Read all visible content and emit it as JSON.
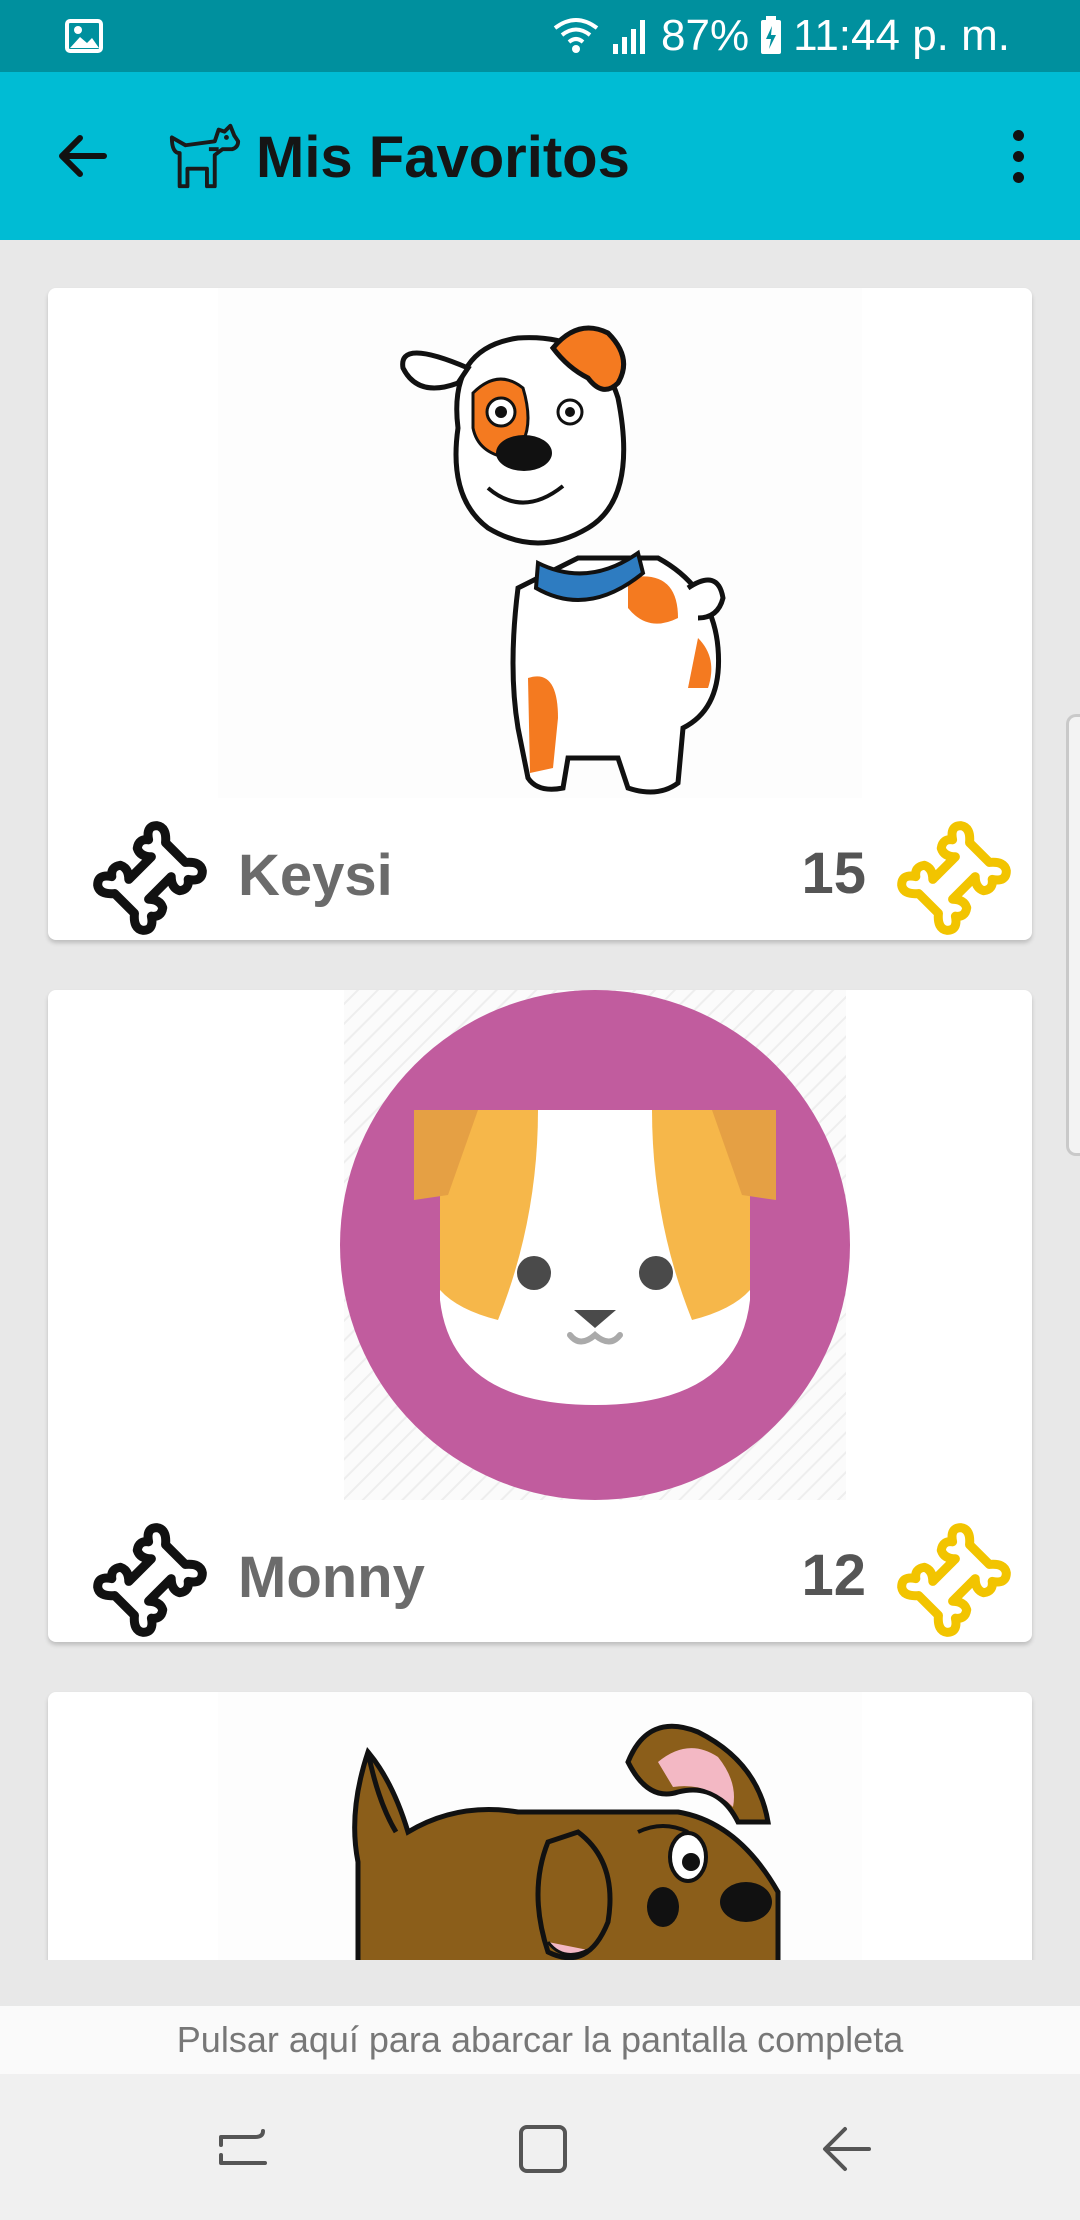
{
  "status_bar": {
    "battery": "87%",
    "time": "11:44 p. m."
  },
  "app_bar": {
    "title": "Mis Favoritos",
    "back_icon": "arrow-back-icon",
    "title_icon": "dog-icon",
    "menu_icon": "more-vert-icon"
  },
  "favorites": [
    {
      "name": "Keysi",
      "count": "15"
    },
    {
      "name": "Monny",
      "count": "12"
    },
    {
      "name": "",
      "count": ""
    }
  ],
  "hint": "Pulsar aquí para abarcar la pantalla completa",
  "colors": {
    "status_bar": "#00909e",
    "app_bar": "#00bcd4",
    "bone_gold": "#f2c400",
    "circle_magenta": "#c15c9e"
  }
}
